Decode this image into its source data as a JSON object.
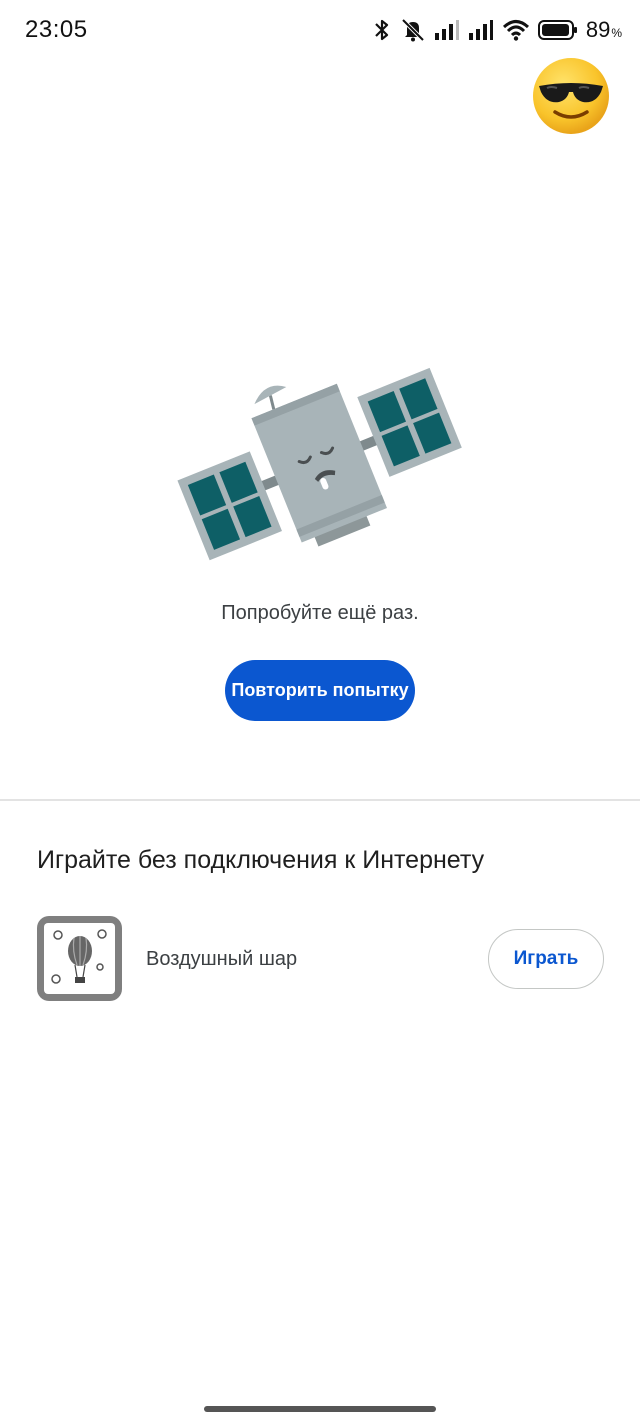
{
  "status_bar": {
    "time": "23:05",
    "battery_percent": "89",
    "battery_percent_sign": "%",
    "icons": [
      "bluetooth-icon",
      "mute-icon",
      "signal-icon",
      "signal-icon-2",
      "wifi-icon",
      "battery-icon"
    ]
  },
  "avatar": {
    "icon": "sunglasses-emoji-icon"
  },
  "error": {
    "illustration": "sleeping-satellite-icon",
    "message": "Попробуйте ещё раз.",
    "retry_label": "Повторить попытку"
  },
  "offline_games": {
    "heading": "Играйте без подключения к Интернету",
    "games": [
      {
        "title": "Воздушный шар",
        "icon": "hot-air-balloon-icon",
        "play_label": "Играть"
      }
    ]
  },
  "colors": {
    "primary": "#0b57d0",
    "satellite_body": "#a8b4b8",
    "solar_panel": "#0e5f66"
  }
}
